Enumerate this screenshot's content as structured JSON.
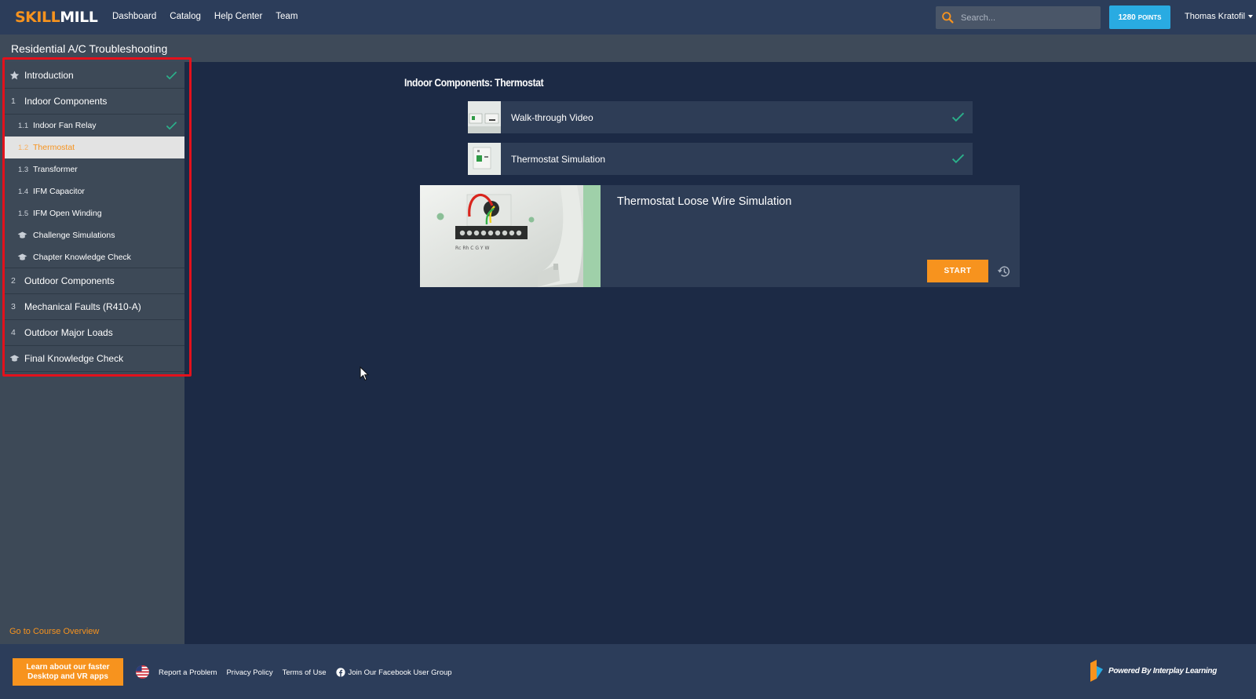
{
  "brand": {
    "part1": "SKILL",
    "part2": "MILL"
  },
  "nav": [
    "Dashboard",
    "Catalog",
    "Help Center",
    "Team"
  ],
  "search": {
    "placeholder": "Search..."
  },
  "points": {
    "value": "1280",
    "unit": "POINTS"
  },
  "user": {
    "name": "Thomas Kratofil"
  },
  "course": {
    "title": "Residential A/C Troubleshooting"
  },
  "sidebar": {
    "items": [
      {
        "type": "chapter",
        "num": "",
        "icon": "star-icon",
        "label": "Introduction",
        "completed": true
      },
      {
        "type": "chapter",
        "num": "1",
        "label": "Indoor Components",
        "completed": false
      },
      {
        "type": "sub",
        "num": "1.1",
        "label": "Indoor Fan Relay",
        "completed": true
      },
      {
        "type": "sub",
        "num": "1.2",
        "label": "Thermostat",
        "active": true
      },
      {
        "type": "sub",
        "num": "1.3",
        "label": "Transformer"
      },
      {
        "type": "sub",
        "num": "1.4",
        "label": "IFM Capacitor"
      },
      {
        "type": "sub",
        "num": "1.5",
        "label": "IFM Open Winding"
      },
      {
        "type": "sub",
        "icon": "graduation-cap-icon",
        "label": "Challenge Simulations"
      },
      {
        "type": "sub",
        "icon": "graduation-cap-icon",
        "label": "Chapter Knowledge Check"
      },
      {
        "type": "chapter",
        "num": "2",
        "label": "Outdoor Components"
      },
      {
        "type": "chapter",
        "num": "3",
        "label": "Mechanical Faults (R410-A)"
      },
      {
        "type": "chapter",
        "num": "4",
        "label": "Outdoor Major Loads"
      },
      {
        "type": "chapter",
        "icon": "graduation-cap-icon",
        "label": "Final Knowledge Check"
      }
    ],
    "overview_link": "Go to Course Overview"
  },
  "main": {
    "heading": "Indoor Components: Thermostat",
    "items": [
      {
        "title": "Walk-through Video",
        "completed": true
      },
      {
        "title": "Thermostat Simulation",
        "completed": true
      }
    ],
    "feature": {
      "title": "Thermostat Loose Wire Simulation",
      "start_label": "START",
      "terminals": "Rc Rh C G Y W"
    }
  },
  "footer": {
    "promo_line1": "Learn about our faster",
    "promo_line2": "Desktop and VR apps",
    "links": [
      "Report a Problem",
      "Privacy Policy",
      "Terms of Use",
      "Join Our Facebook User Group"
    ],
    "powered_by": "Powered By Interplay Learning"
  },
  "colors": {
    "accent": "#f7931e",
    "points_blue": "#29abe2",
    "check_green": "#2bb08a",
    "outline_red": "#e3111c",
    "bg": "#1c2a45"
  }
}
